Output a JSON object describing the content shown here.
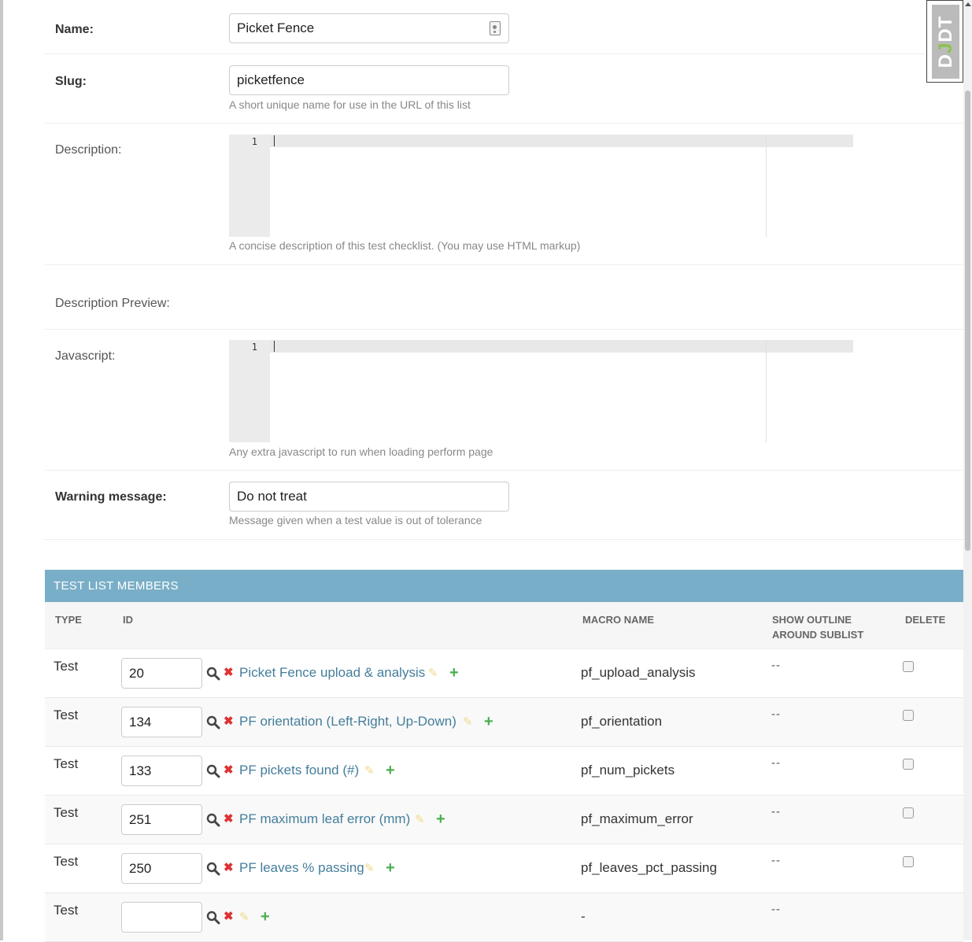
{
  "form": {
    "name": {
      "label": "Name:",
      "value": "Picket Fence"
    },
    "slug": {
      "label": "Slug:",
      "value": "picketfence",
      "help": "A short unique name for use in the URL of this list"
    },
    "description": {
      "label": "Description:",
      "line_number": "1",
      "help": "A concise description of this test checklist. (You may use HTML markup)"
    },
    "description_preview": {
      "label": "Description Preview:"
    },
    "javascript": {
      "label": "Javascript:",
      "line_number": "1",
      "help": "Any extra javascript to run when loading perform page"
    },
    "warning_message": {
      "label": "Warning message:",
      "value": "Do not treat",
      "help": "Message given when a test value is out of tolerance"
    }
  },
  "inline": {
    "title": "TEST LIST MEMBERS",
    "columns": {
      "type": "TYPE",
      "id": "ID",
      "macro_name": "MACRO NAME",
      "show_outline": "SHOW OUTLINE AROUND SUBLIST",
      "delete": "DELETE"
    },
    "rows": [
      {
        "type": "Test",
        "id": "20",
        "name": "Picket Fence upload & analysis",
        "macro": "pf_upload_analysis",
        "outline": "--"
      },
      {
        "type": "Test",
        "id": "134",
        "name": "PF orientation (Left-Right, Up-Down)",
        "macro": "pf_orientation",
        "outline": "--"
      },
      {
        "type": "Test",
        "id": "133",
        "name": "PF pickets found (#)",
        "macro": "pf_num_pickets",
        "outline": "--"
      },
      {
        "type": "Test",
        "id": "251",
        "name": "PF maximum leaf error (mm)",
        "macro": "pf_maximum_error",
        "outline": "--"
      },
      {
        "type": "Test",
        "id": "250",
        "name": "PF leaves % passing",
        "macro": "pf_leaves_pct_passing",
        "outline": "--"
      },
      {
        "type": "Test",
        "id": "",
        "name": "",
        "macro": "-",
        "outline": "--"
      }
    ]
  },
  "toolbar": {
    "djdt_label": "DJDT"
  },
  "colors": {
    "header": "#79aec8",
    "link": "#447e9b",
    "delete_icon": "#dd3333",
    "add_icon": "#4caf50"
  },
  "icons": {
    "lookup": "magnifier-icon",
    "delete_related": "x-icon",
    "change_related": "pencil-icon",
    "add_related": "plus-icon"
  }
}
